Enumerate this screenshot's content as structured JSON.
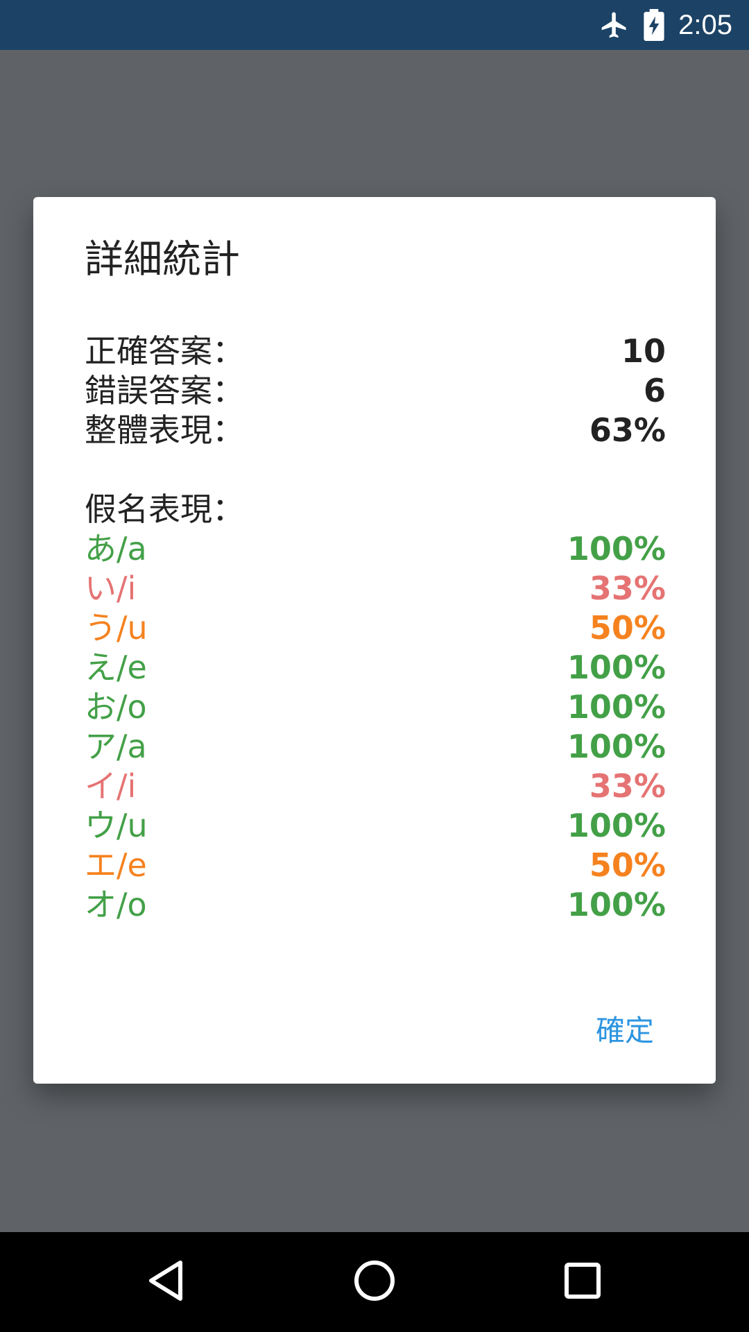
{
  "status_bar": {
    "time": "2:05",
    "icons": [
      "airplane-mode-icon",
      "battery-charging-icon"
    ]
  },
  "dialog": {
    "title": "詳細統計",
    "summary": [
      {
        "label": "正確答案：",
        "value": "10"
      },
      {
        "label": "錯誤答案：",
        "value": "6"
      },
      {
        "label": "整體表現：",
        "value": "63%"
      }
    ],
    "kana_section_title": "假名表現：",
    "kana": [
      {
        "label": "あ/a",
        "value": "100%",
        "color": "#43a047"
      },
      {
        "label": "い/i",
        "value": "33%",
        "color": "#e57373"
      },
      {
        "label": "う/u",
        "value": "50%",
        "color": "#f5821f"
      },
      {
        "label": "え/e",
        "value": "100%",
        "color": "#43a047"
      },
      {
        "label": "お/o",
        "value": "100%",
        "color": "#43a047"
      },
      {
        "label": "ア/a",
        "value": "100%",
        "color": "#43a047"
      },
      {
        "label": "イ/i",
        "value": "33%",
        "color": "#e57373"
      },
      {
        "label": "ウ/u",
        "value": "100%",
        "color": "#43a047"
      },
      {
        "label": "エ/e",
        "value": "50%",
        "color": "#f5821f"
      },
      {
        "label": "オ/o",
        "value": "100%",
        "color": "#43a047"
      }
    ],
    "confirm_label": "確定"
  },
  "colors": {
    "status_bar": "#1c4366",
    "scrim": "#5f6367",
    "accent": "#2d95e0",
    "good": "#43a047",
    "bad": "#e57373",
    "medium": "#f5821f"
  },
  "nav_bar": {
    "icons": [
      "back-icon",
      "home-icon",
      "recents-icon"
    ]
  }
}
